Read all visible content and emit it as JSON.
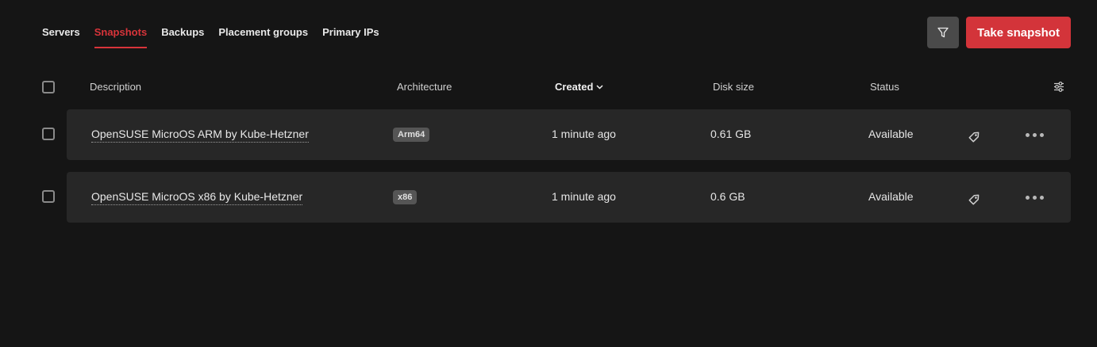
{
  "tabs": [
    {
      "label": "Servers"
    },
    {
      "label": "Snapshots"
    },
    {
      "label": "Backups"
    },
    {
      "label": "Placement groups"
    },
    {
      "label": "Primary IPs"
    }
  ],
  "actions": {
    "filter_icon": "filter-icon",
    "take_snapshot_label": "Take snapshot"
  },
  "table": {
    "columns": {
      "description": "Description",
      "architecture": "Architecture",
      "created": "Created",
      "disk_size": "Disk size",
      "status": "Status"
    },
    "sort": {
      "column": "created",
      "direction": "desc"
    },
    "rows": [
      {
        "description": "OpenSUSE MicroOS ARM by Kube-Hetzner",
        "architecture": "Arm64",
        "created": "1 minute ago",
        "disk_size": "0.61 GB",
        "status": "Available"
      },
      {
        "description": "OpenSUSE MicroOS x86 by Kube-Hetzner",
        "architecture": "x86",
        "created": "1 minute ago",
        "disk_size": "0.6 GB",
        "status": "Available"
      }
    ]
  },
  "colors": {
    "accent": "#d3343a",
    "background": "#151515",
    "row_background": "#272727"
  }
}
